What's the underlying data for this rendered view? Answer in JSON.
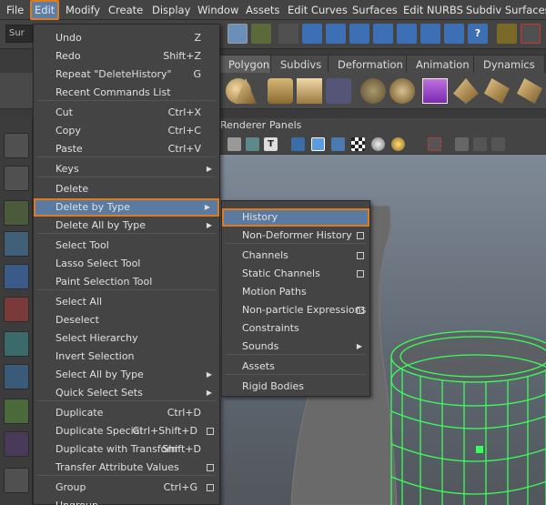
{
  "menubar": {
    "items": [
      "File",
      "Edit",
      "Modify",
      "Create",
      "Display",
      "Window",
      "Assets",
      "Edit Curves",
      "Surfaces",
      "Edit NURBS",
      "Subdiv Surfaces"
    ]
  },
  "statusline": {
    "field_text": "Sur"
  },
  "shelf_tabs": [
    "Polygons",
    "Subdivs",
    "Deformation",
    "Animation",
    "Dynamics"
  ],
  "panel_menu": [
    "Renderer",
    "Panels"
  ],
  "edit_menu": {
    "items": [
      {
        "label": "Undo",
        "shortcut": "Z"
      },
      {
        "label": "Redo",
        "shortcut": "Shift+Z"
      },
      {
        "label": "Repeat \"DeleteHistory\"",
        "shortcut": "G"
      },
      {
        "label": "Recent Commands List",
        "shortcut": ""
      },
      {
        "label": "Cut",
        "shortcut": "Ctrl+X"
      },
      {
        "label": "Copy",
        "shortcut": "Ctrl+C"
      },
      {
        "label": "Paste",
        "shortcut": "Ctrl+V"
      },
      {
        "label": "Keys",
        "shortcut": ""
      },
      {
        "label": "Delete",
        "shortcut": ""
      },
      {
        "label": "Delete by Type",
        "shortcut": ""
      },
      {
        "label": "Delete All by Type",
        "shortcut": ""
      },
      {
        "label": "Select Tool",
        "shortcut": ""
      },
      {
        "label": "Lasso Select Tool",
        "shortcut": ""
      },
      {
        "label": "Paint Selection Tool",
        "shortcut": ""
      },
      {
        "label": "Select All",
        "shortcut": ""
      },
      {
        "label": "Deselect",
        "shortcut": ""
      },
      {
        "label": "Select Hierarchy",
        "shortcut": ""
      },
      {
        "label": "Invert Selection",
        "shortcut": ""
      },
      {
        "label": "Select All by Type",
        "shortcut": ""
      },
      {
        "label": "Quick Select Sets",
        "shortcut": ""
      },
      {
        "label": "Duplicate",
        "shortcut": "Ctrl+D"
      },
      {
        "label": "Duplicate Special",
        "shortcut": "Ctrl+Shift+D"
      },
      {
        "label": "Duplicate with Transform",
        "shortcut": "Shift+D"
      },
      {
        "label": "Transfer Attribute Values",
        "shortcut": ""
      },
      {
        "label": "Group",
        "shortcut": "Ctrl+G"
      },
      {
        "label": "Ungroup",
        "shortcut": ""
      }
    ]
  },
  "submenu": {
    "items": [
      {
        "label": "History"
      },
      {
        "label": "Non-Deformer History"
      },
      {
        "label": "Channels"
      },
      {
        "label": "Static Channels"
      },
      {
        "label": "Motion Paths"
      },
      {
        "label": "Non-particle Expressions"
      },
      {
        "label": "Constraints"
      },
      {
        "label": "Sounds"
      },
      {
        "label": "Assets"
      },
      {
        "label": "Rigid Bodies"
      }
    ]
  },
  "colors": {
    "highlight": "#5b7aa0",
    "accent_border": "#e07a1f",
    "wireframe": "#39ff5a"
  }
}
